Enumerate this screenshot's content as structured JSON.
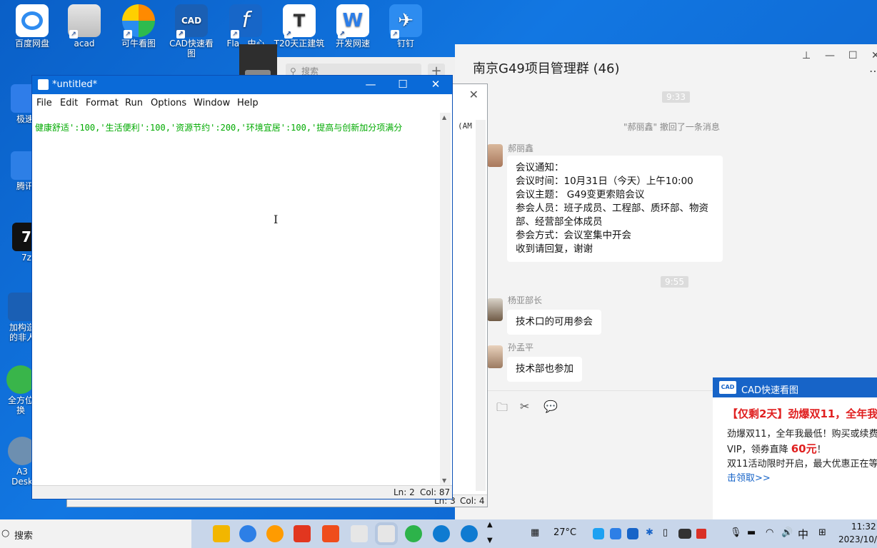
{
  "desktop": {
    "top_icons": [
      {
        "label": "百度网盘",
        "color": "#2f8cf0"
      },
      {
        "label": "acad",
        "color": "#d0d0d0"
      },
      {
        "label": "可牛看图",
        "color": "#ff8a00"
      },
      {
        "label": "CAD快速看\n图",
        "color": "#1a5fb4"
      },
      {
        "label": "Fla...中心",
        "color": "#1766c8"
      },
      {
        "label": "T20天正建筑",
        "color": "#333333"
      },
      {
        "label": "开发网速",
        "color": "#2b7de9"
      },
      {
        "label": "钉钉",
        "color": "#2d8cf0"
      }
    ],
    "left_icons": [
      {
        "label": "极速",
        "color": "#2f7de9"
      },
      {
        "label": "腾讯",
        "color": "#2d7fe6"
      },
      {
        "label": "7z",
        "color": "#111111"
      },
      {
        "label": "加构造\n的非人",
        "color": "#1a5fb4"
      },
      {
        "label": "全方位\n换",
        "color": "#39b54a"
      },
      {
        "label": "A3\nDesk",
        "color": "#6d8fb0"
      }
    ]
  },
  "qq_panel": {
    "search_placeholder": "搜索",
    "plus": "+"
  },
  "chat": {
    "title": "南京G49项目管理群 (46)",
    "window_controls": {
      "pin": "⊥",
      "min": "—",
      "max": "☐",
      "close": "✕"
    },
    "more": "⋯",
    "time1": "9:33",
    "recall_notice": "\"郝丽鑫\" 撤回了一条消息",
    "msg1_sender": "郝丽鑫",
    "msg1_lines": [
      "会议通知：",
      "会议时间：10月31日（今天）上午10:00",
      "会议主题： G49变更索赔会议",
      "参会人员：班子成员、工程部、质环部、物资",
      "部、经营部全体成员",
      "参会方式：会议室集中开会",
      "收到请回复，谢谢"
    ],
    "time2": "9:55",
    "msg2_sender": "杨亚部长",
    "msg2_text": "技术口的可用参会",
    "msg3_sender": "孙孟平",
    "msg3_text": "技术部也参加"
  },
  "editor_back": {
    "text": "(AM",
    "status_ln": "Ln: 3",
    "status_col": "Col: 4"
  },
  "editor": {
    "title": "*untitled*",
    "menu": [
      "File",
      "Edit",
      "Format",
      "Run",
      "Options",
      "Window",
      "Help"
    ],
    "code": "健康舒适':100,'生活便利':100,'资源节约':200,'环境宜居':100,'提高与创新加分项满分",
    "status_ln": "Ln: 2",
    "status_col": "Col: 87",
    "controls": {
      "min": "—",
      "max": "☐",
      "close": "✕"
    }
  },
  "popup": {
    "app_name": "CAD快速看图",
    "logo_text": "CAD",
    "headline": "【仅剩2天】劲爆双11，全年我",
    "body_line1": "劲爆双11，全年我最低！购买或续费",
    "body_line2_pre": "VIP，领券直降 ",
    "body_line2_red": "60元",
    "body_line2_post": "！",
    "body_line3": "双11活动限时开启，最大优惠正在等",
    "body_link": "击领取>>"
  },
  "taskbar": {
    "search_label": "搜索",
    "weather": "27°C",
    "ime": "中",
    "time": "11:32",
    "date": "2023/10/"
  }
}
